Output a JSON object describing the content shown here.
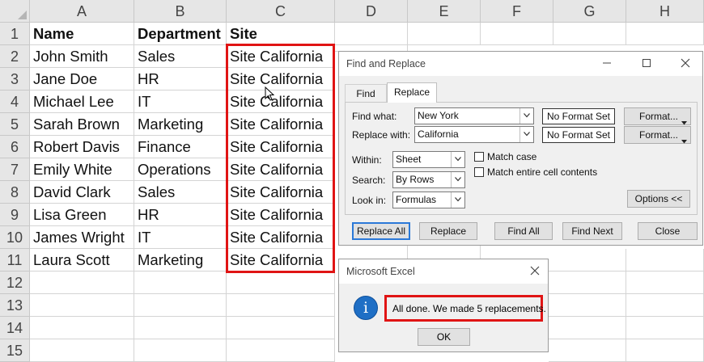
{
  "sheet": {
    "columns": [
      "A",
      "B",
      "C",
      "D",
      "E",
      "F",
      "G",
      "H"
    ],
    "rows": [
      "1",
      "2",
      "3",
      "4",
      "5",
      "6",
      "7",
      "8",
      "9",
      "10",
      "11",
      "12",
      "13",
      "14",
      "15"
    ],
    "header": {
      "name": "Name",
      "department": "Department",
      "site": "Site"
    },
    "data": [
      {
        "name": "John Smith",
        "department": "Sales",
        "site": "Site California"
      },
      {
        "name": "Jane Doe",
        "department": "HR",
        "site": "Site California"
      },
      {
        "name": "Michael Lee",
        "department": "IT",
        "site": "Site California"
      },
      {
        "name": "Sarah Brown",
        "department": "Marketing",
        "site": "Site California"
      },
      {
        "name": "Robert Davis",
        "department": "Finance",
        "site": "Site California"
      },
      {
        "name": "Emily White",
        "department": "Operations",
        "site": "Site California"
      },
      {
        "name": "David Clark",
        "department": "Sales",
        "site": "Site California"
      },
      {
        "name": "Lisa Green",
        "department": "HR",
        "site": "Site California"
      },
      {
        "name": "James Wright",
        "department": "IT",
        "site": "Site California"
      },
      {
        "name": "Laura Scott",
        "department": "Marketing",
        "site": "Site California"
      }
    ],
    "highlight_color": "#e01414"
  },
  "find_replace": {
    "title": "Find and Replace",
    "tabs": {
      "find": "Find",
      "replace": "Replace"
    },
    "find_what_label": "Find what:",
    "find_what_value": "New York",
    "replace_with_label": "Replace with:",
    "replace_with_value": "California",
    "no_format_set": "No Format Set",
    "format_button": "Format...",
    "within_label": "Within:",
    "within_value": "Sheet",
    "search_label": "Search:",
    "search_value": "By Rows",
    "look_in_label": "Look in:",
    "look_in_value": "Formulas",
    "match_case": "Match case",
    "match_entire": "Match entire cell contents",
    "options_button": "Options <<",
    "buttons": {
      "replace_all": "Replace All",
      "replace": "Replace",
      "find_all": "Find All",
      "find_next": "Find Next",
      "close": "Close"
    }
  },
  "message_box": {
    "title": "Microsoft Excel",
    "icon": "info-icon",
    "message": "All done. We made 5 replacements.",
    "ok": "OK"
  }
}
